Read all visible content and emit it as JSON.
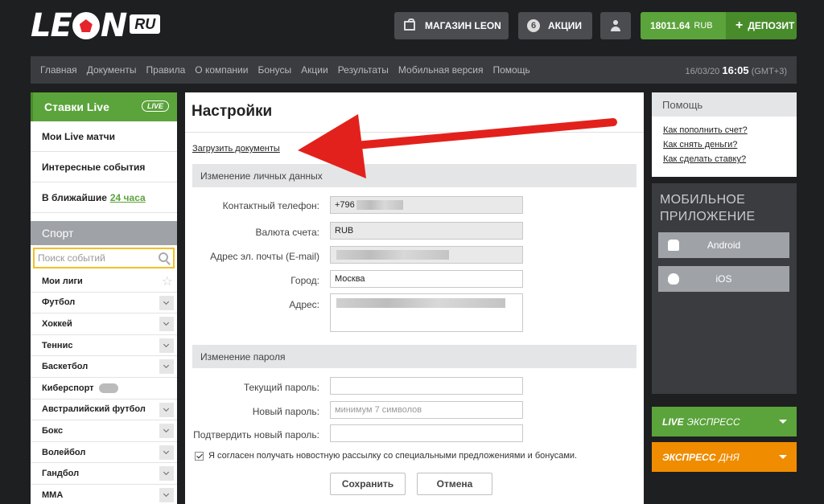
{
  "header": {
    "logo_text": "LE",
    "logo_text2": "N",
    "logo_badge": "RU",
    "shop_label": "МАГАЗИН LEON",
    "promo_count": "6",
    "promo_label": "АКЦИИ",
    "balance_value": "18011.64",
    "balance_currency": "RUB",
    "deposit_label": "ДЕПОЗИТ",
    "brand_color": "#5ba33b"
  },
  "nav": {
    "items": [
      "Главная",
      "Документы",
      "Правила",
      "О компании",
      "Бонусы",
      "Акции",
      "Результаты",
      "Мобильная версия",
      "Помощь"
    ],
    "date": "16/03/20",
    "time": "16:05",
    "tz": "(GMT+3)"
  },
  "left": {
    "live_title": "Ставки Live",
    "live_badge": "LIVE",
    "links": [
      "Мои Live матчи",
      "Интересные события"
    ],
    "soon_label": "В ближайшие",
    "soon_highlight": "24 часа",
    "sport_title": "Спорт",
    "search_placeholder": "Поиск событий",
    "my_leagues": "Мои лиги",
    "sports": [
      "Футбол",
      "Хоккей",
      "Теннис",
      "Баскетбол",
      "Киберспорт",
      "Австралийский футбол",
      "Бокс",
      "Волейбол",
      "Гандбол",
      "MMA"
    ]
  },
  "main": {
    "title": "Настройки",
    "upload_link": "Загрузить документы",
    "section_personal": "Изменение личных данных",
    "phone_label": "Контактный телефон:",
    "phone_value": "+796",
    "currency_label": "Валюта счета:",
    "currency_value": "RUB",
    "email_label": "Адрес эл. почты (E-mail)",
    "city_label": "Город:",
    "city_value": "Москва",
    "address_label": "Адрес:",
    "section_password": "Изменение пароля",
    "current_pw_label": "Текущий пароль:",
    "new_pw_label": "Новый пароль:",
    "new_pw_placeholder": "минимум 7 символов",
    "confirm_pw_label": "Подтвердить новый пароль:",
    "newsletter_label": "Я согласен получать новостную рассылку со специальными предложениями и бонусами.",
    "save_label": "Сохранить",
    "cancel_label": "Отмена"
  },
  "right": {
    "help_title": "Помощь",
    "help_links": [
      "Как пополнить счет?",
      "Как снять деньги?",
      "Как сделать ставку?"
    ],
    "app_title_1": "МОБИЛЬНОЕ",
    "app_title_2": "ПРИЛОЖЕНИЕ",
    "android_label": "Android",
    "ios_label": "iOS",
    "live_express_bold": "LIVE",
    "live_express_rest": "ЭКСПРЕСС",
    "day_express_bold": "ЭКСПРЕСС",
    "day_express_rest": "ДНЯ",
    "accent_orange": "#f08c00"
  }
}
